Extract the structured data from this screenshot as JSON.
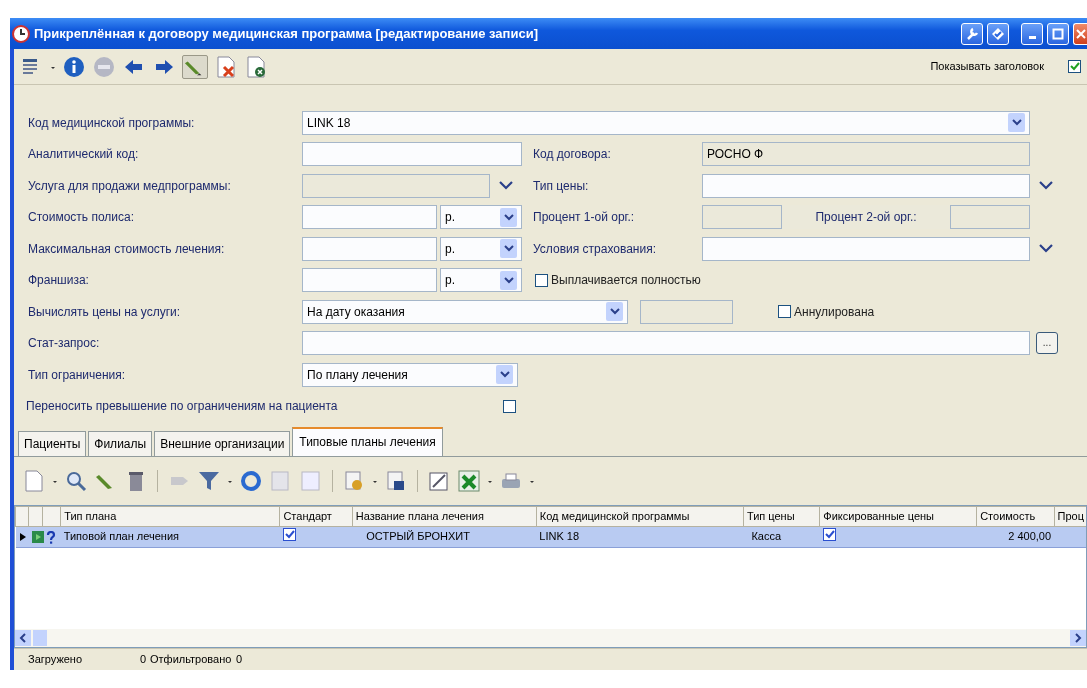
{
  "window": {
    "title": "Прикреплённая к договору медицинская программа [редактирование записи]"
  },
  "toolbar": {
    "show_header": {
      "label": "Показывать заголовок",
      "checked": true
    }
  },
  "form": {
    "program_code": {
      "label": "Код медицинской программы:",
      "value": "LINK 18"
    },
    "analytic_code": {
      "label": "Аналитический код:"
    },
    "contract_code": {
      "label": "Код договора:",
      "value": "РОСНО Ф"
    },
    "service": {
      "label": "Услуга для продажи медпрограммы:"
    },
    "price_type": {
      "label": "Тип цены:"
    },
    "policy_cost": {
      "label": "Стоимость полиса:",
      "currency": "р."
    },
    "percent_1": {
      "label": "Процент 1-ой орг.:"
    },
    "percent_2": {
      "label": "Процент 2-ой орг.:"
    },
    "max_cost": {
      "label": "Максимальная стоимость лечения:",
      "currency": "р."
    },
    "insurance_terms": {
      "label": "Условия страхования:"
    },
    "franchise": {
      "label": "Франшиза:",
      "currency": "р."
    },
    "paid_fully": {
      "label": "Выплачивается полностью",
      "checked": false
    },
    "price_calc": {
      "label": "Вычислять цены на услуги:",
      "value": "На дату оказания"
    },
    "cancelled": {
      "label": "Аннулирована",
      "checked": false
    },
    "stat_request": {
      "label": "Стат-запрос:",
      "button": "..."
    },
    "limit_type": {
      "label": "Тип ограничения:",
      "value": "По плану лечения"
    },
    "transfer_excess": {
      "label": "Переносить превышение по ограничениям на пациента",
      "checked": false
    }
  },
  "tabs": [
    {
      "label": "Пациенты",
      "selected": false
    },
    {
      "label": "Филиалы",
      "selected": false
    },
    {
      "label": "Внешние организации",
      "selected": false
    },
    {
      "label": "Типовые планы лечения",
      "selected": true
    }
  ],
  "table": {
    "columns": [
      "Тип плана",
      "Стандарт",
      "Название плана лечения",
      "Код медицинской программы",
      "Тип цены",
      "Фиксированные цены",
      "Стоимость",
      "Проц"
    ],
    "rows": [
      {
        "selected": true,
        "plan_type": "Типовой план лечения",
        "standard": true,
        "name": "ОСТРЫЙ БРОНХИТ",
        "program_code": "LINK 18",
        "price_type": "Касса",
        "fixed_prices": true,
        "cost": "2 400,00"
      }
    ]
  },
  "status_bar": {
    "loaded_label": "Загружено",
    "loaded": "0",
    "filtered_label": "Отфильтровано",
    "filtered": "0"
  }
}
